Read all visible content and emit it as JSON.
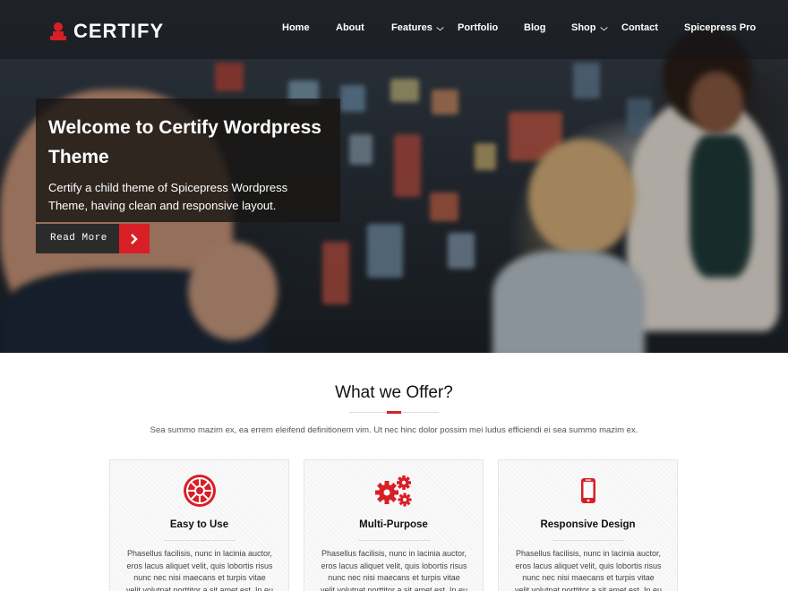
{
  "brand": {
    "name": "CERTIFY",
    "accent": "#d81f26"
  },
  "nav": {
    "items": [
      {
        "label": "Home"
      },
      {
        "label": "About"
      },
      {
        "label": "Features",
        "dropdown": true
      },
      {
        "label": "Portfolio"
      },
      {
        "label": "Blog"
      },
      {
        "label": "Shop",
        "dropdown": true
      },
      {
        "label": "Contact"
      },
      {
        "label": "Spicepress Pro"
      }
    ]
  },
  "hero": {
    "title": "Welcome to Certify Wordpress Theme",
    "description": "Certify a child theme of Spicepress Wordpress Theme, having clean and responsive layout.",
    "button_label": "Read More"
  },
  "offer": {
    "title": "What we Offer?",
    "subtitle": "Sea summo mazim ex, ea errem eleifend definitionem vim. Ut nec hinc dolor possim mei ludus efficiendi ei sea summo mazim ex.",
    "cards": [
      {
        "icon": "empire-icon",
        "title": "Easy to Use",
        "text": "Phasellus facilisis, nunc in lacinia auctor, eros lacus aliquet velit, quis lobortis risus nunc nec nisi maecans et turpis vitae velit.volutpat porttitor a sit amet est. In eu rutrum ante."
      },
      {
        "icon": "gears-icon",
        "title": "Multi-Purpose",
        "text": "Phasellus facilisis, nunc in lacinia auctor, eros lacus aliquet velit, quis lobortis risus nunc nec nisi maecans et turpis vitae velit.volutpat porttitor a sit amet est. In eu rutrum ante."
      },
      {
        "icon": "mobile-icon",
        "title": "Responsive Design",
        "text": "Phasellus facilisis, nunc in lacinia auctor, eros lacus aliquet velit, quis lobortis risus nunc nec nisi maecans et turpis vitae velit.volutpat porttitor a sit amet est. In eu rutrum ante."
      }
    ]
  }
}
